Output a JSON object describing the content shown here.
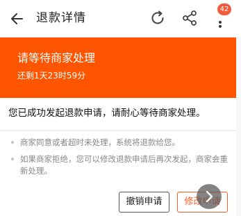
{
  "header": {
    "title": "退款详情",
    "badge_count": "42"
  },
  "status": {
    "title": "请等待商家处理",
    "remaining": "还剩1天23时59分"
  },
  "notice": {
    "text": "您已成功发起退款申请，请耐心等待商家处理。"
  },
  "tips": [
    "商家同意或者超时未处理，系统将退款给您。",
    "如果商家拒绝，您可以修改退款申请后再次发起，商家会重新处理。"
  ],
  "tips_split": {
    "line1": "如果商家拒绝，您可以修改退款申请后再次发起，商家会重",
    "line2": "新处理。"
  },
  "actions": {
    "cancel_label": "撤销申请",
    "modify_label": "修改申请"
  },
  "icons": {
    "back": "back-arrow-icon",
    "refresh": "refresh-icon",
    "share": "share-icon",
    "more": "more-vertical-icon",
    "next": "chevron-right-icon"
  },
  "colors": {
    "accent": "#ff5500",
    "badge": "#f05c3b",
    "modify_border": "#ff5a1f"
  }
}
